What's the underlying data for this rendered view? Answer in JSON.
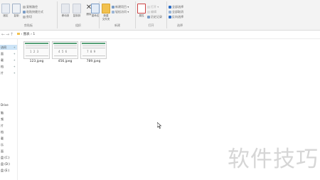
{
  "ribbon": {
    "clipboard": {
      "group_label": "剪贴板",
      "pin_label": "固定",
      "copy_label": "复制",
      "copy_path": "复制路径",
      "paste_shortcut": "粘贴快捷方式",
      "cut": "剪切"
    },
    "organize": {
      "group_label": "组织",
      "move_to": "移动到",
      "copy_to": "复制到",
      "delete": "删除",
      "rename": "重命名"
    },
    "new": {
      "group_label": "新建",
      "new_folder": "新建\n文件夹",
      "new_item": "新建项目",
      "easy_access": "轻松访问"
    },
    "open": {
      "group_label": "打开",
      "properties": "属性",
      "open": "打开",
      "edit": "编辑",
      "history": "历史记录"
    },
    "select": {
      "group_label": "选择",
      "select_all": "全部选择",
      "select_none": "全部取消",
      "invert": "反向选择"
    }
  },
  "address": {
    "back": "←",
    "forward": "→",
    "up": "↑",
    "crumb_root": "图表",
    "crumb_sep": "›",
    "crumb_current": "1"
  },
  "sidebar": {
    "items": [
      {
        "label": "访问",
        "pin": "✦"
      },
      {
        "label": "面",
        "pin": "✦"
      },
      {
        "label": "载",
        "pin": "✦"
      },
      {
        "label": "档",
        "pin": "✦"
      },
      {
        "label": "片",
        "pin": "✦"
      },
      {
        "label": "Drive",
        "pin": ""
      },
      {
        "label": "脑",
        "pin": ""
      },
      {
        "label": "频",
        "pin": ""
      },
      {
        "label": "片",
        "pin": ""
      },
      {
        "label": "档",
        "pin": ""
      },
      {
        "label": "载",
        "pin": ""
      },
      {
        "label": "乐",
        "pin": ""
      },
      {
        "label": "面",
        "pin": ""
      },
      {
        "label": "盘 (C:)",
        "pin": ""
      },
      {
        "label": "盘 (D:)",
        "pin": ""
      },
      {
        "label": "盘 (E:)",
        "pin": ""
      }
    ]
  },
  "files": [
    {
      "name": "123.jpeg",
      "preview": "1 2 3"
    },
    {
      "name": "456.jpeg",
      "preview": "4 5 6"
    },
    {
      "name": "789.jpeg",
      "preview": "7 8 9"
    }
  ],
  "watermark": "软件技巧",
  "colors": {
    "ribbon_bg": "#f3f3f3",
    "accent_blue": "#2b6cc4",
    "thumb_header": "#2e8b57"
  }
}
